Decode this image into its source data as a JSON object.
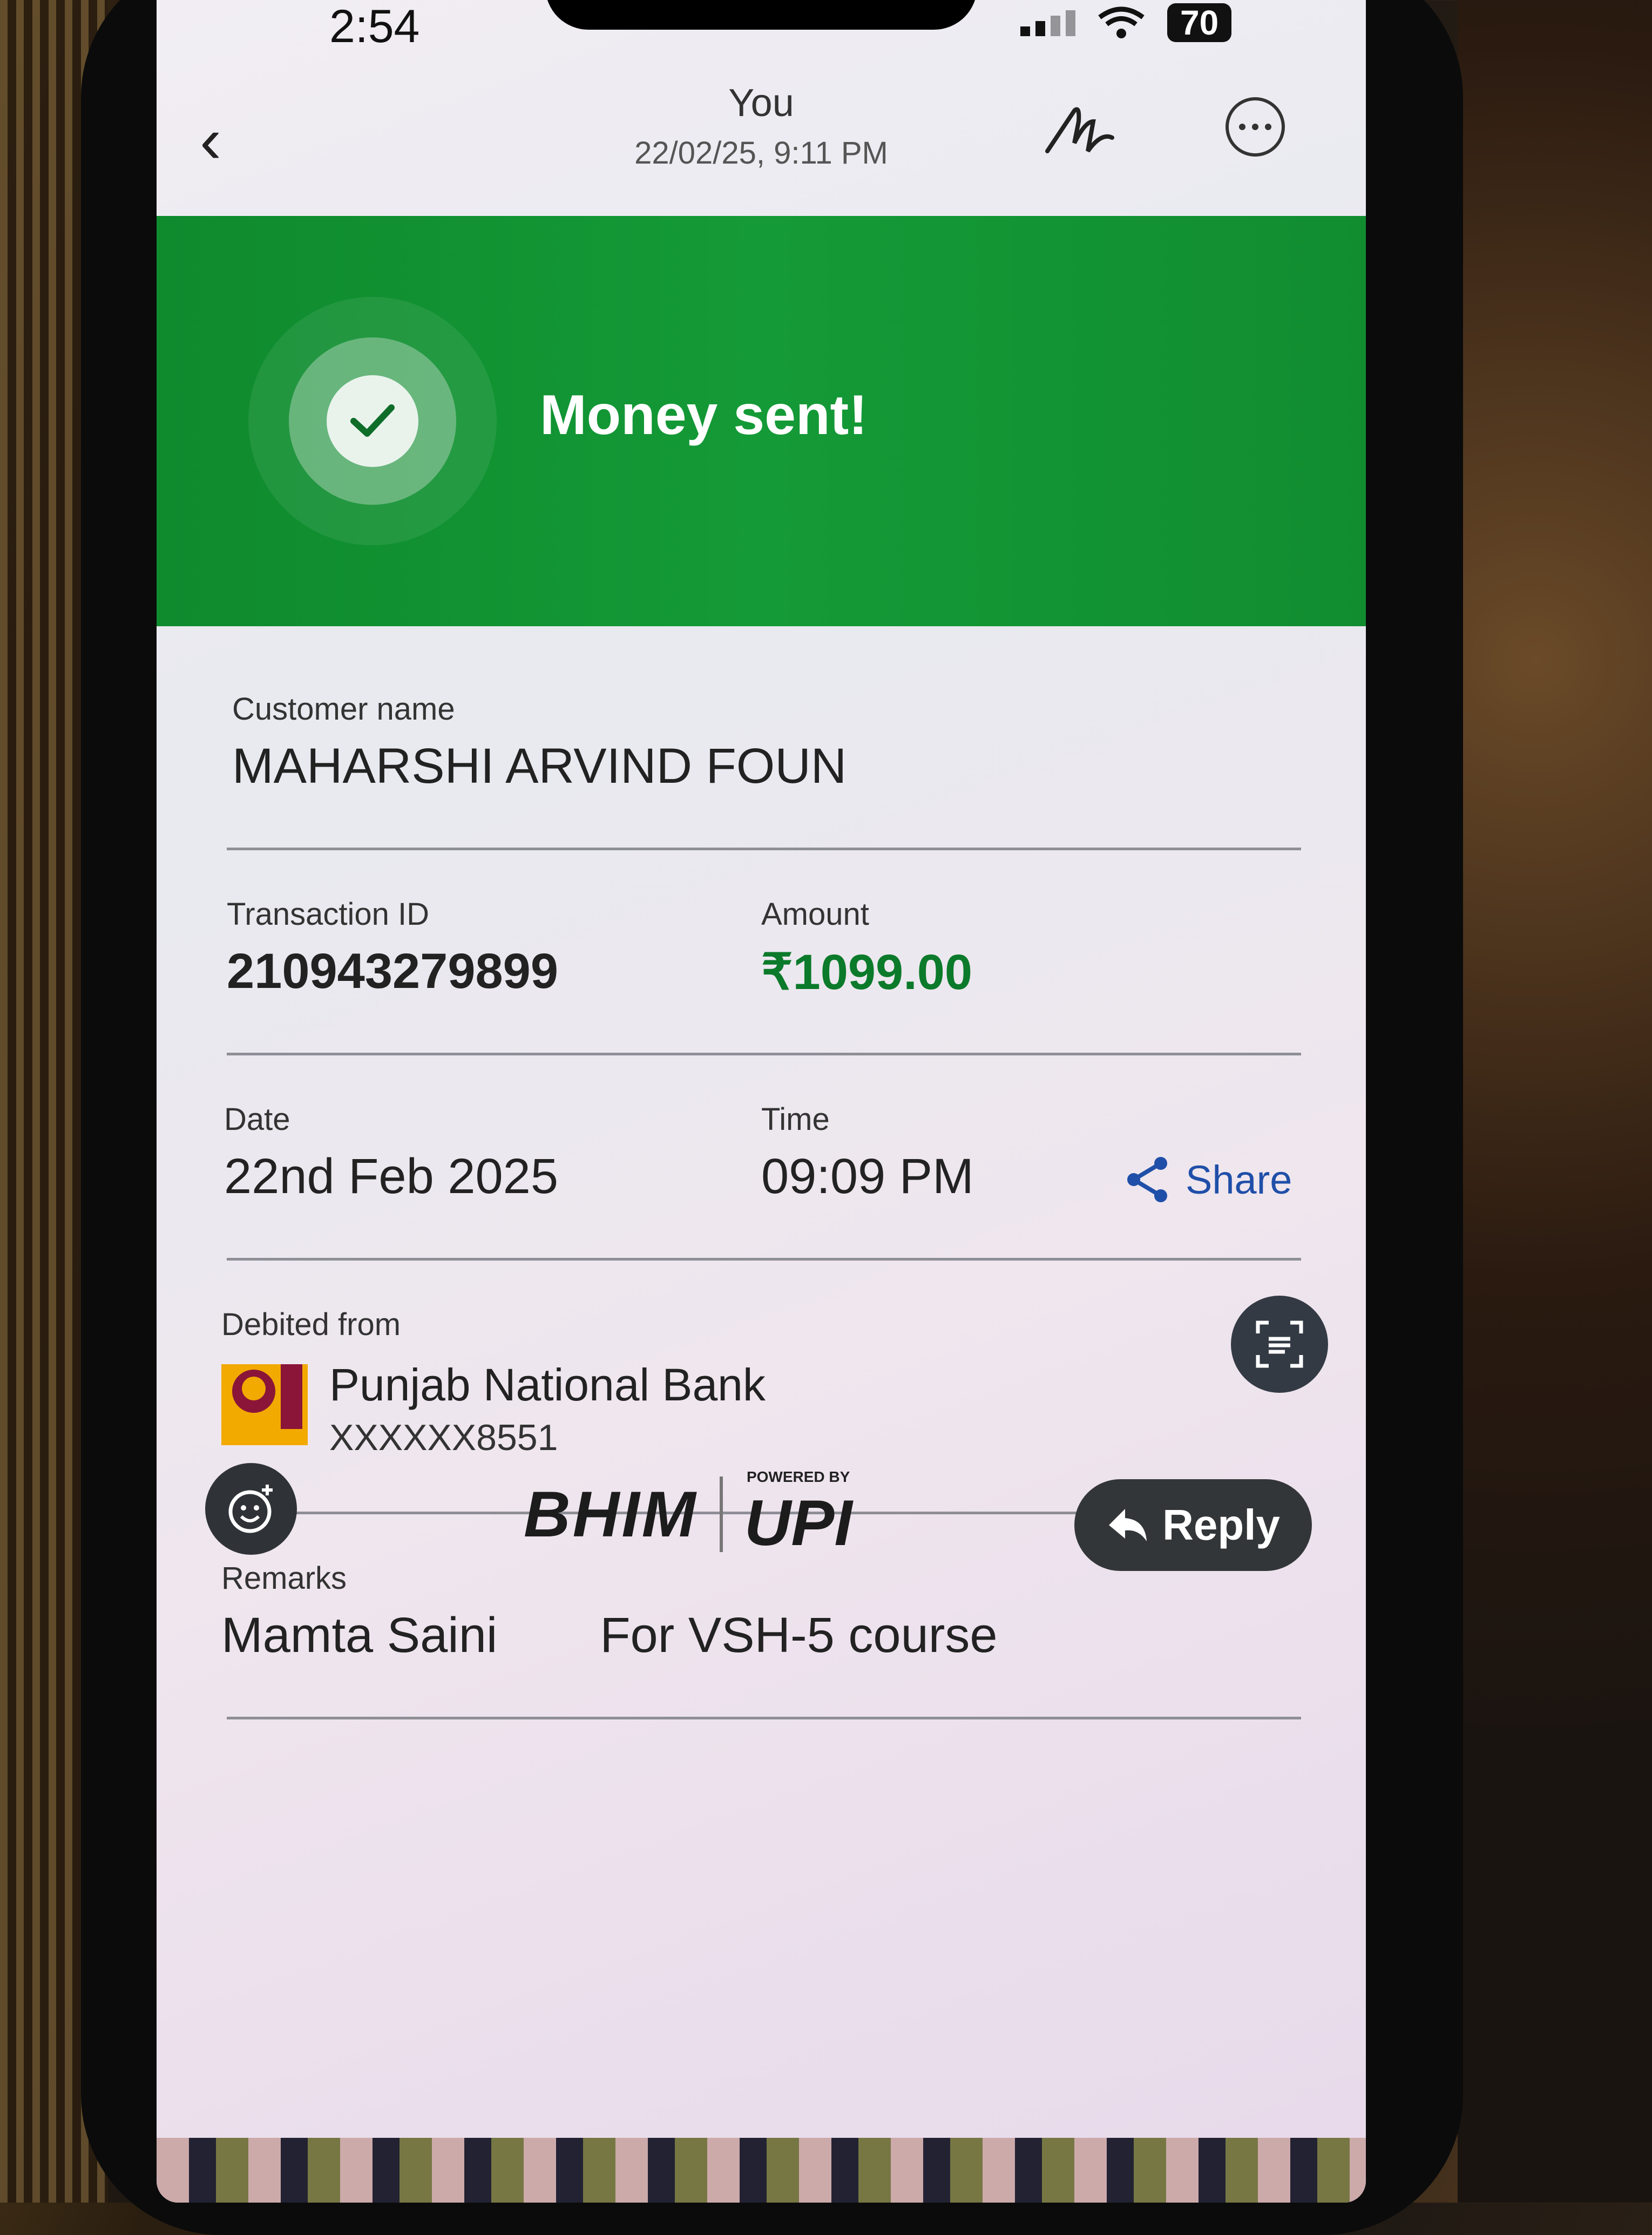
{
  "status_bar": {
    "time": "2:54",
    "battery": "70"
  },
  "nav": {
    "title": "You",
    "subtitle": "22/02/25, 9:11 PM"
  },
  "banner": {
    "title": "Money sent!",
    "color": "#149a37"
  },
  "customer": {
    "label": "Customer name",
    "value": "MAHARSHI ARVIND FOUN"
  },
  "transaction": {
    "id_label": "Transaction ID",
    "id_value": "210943279899",
    "amount_label": "Amount",
    "amount_value": "₹1099.00"
  },
  "datetime": {
    "date_label": "Date",
    "date_value": "22nd Feb 2025",
    "time_label": "Time",
    "time_value": "09:09 PM"
  },
  "debit": {
    "label": "Debited from",
    "bank_name": "Punjab National Bank",
    "account": "XXXXXX8551"
  },
  "remarks": {
    "label": "Remarks",
    "value1": "Mamta Saini",
    "value2": "For VSH-5 course"
  },
  "actions": {
    "share": "Share",
    "reply": "Reply"
  },
  "logos": {
    "bhim": "BHIM",
    "powered_by": "POWERED BY",
    "upi": "UPI"
  }
}
